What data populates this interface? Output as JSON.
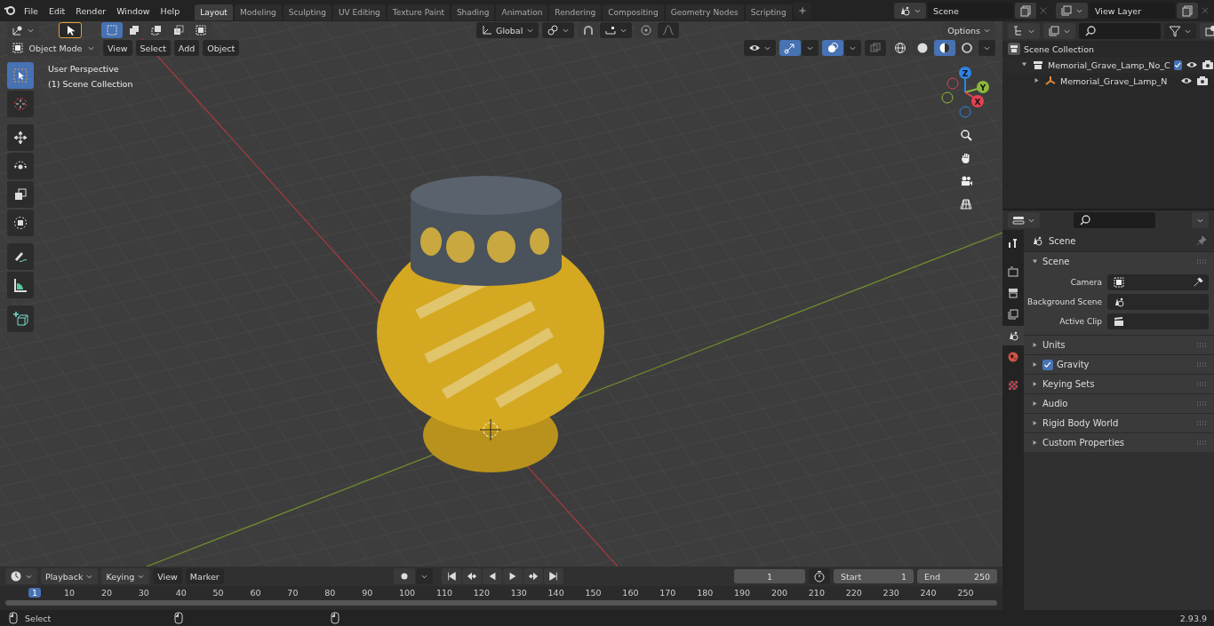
{
  "topbar": {
    "menus": [
      "File",
      "Edit",
      "Render",
      "Window",
      "Help"
    ],
    "workspaces": [
      {
        "label": "Layout",
        "selected": true
      },
      {
        "label": "Modeling",
        "selected": false
      },
      {
        "label": "Sculpting",
        "selected": false
      },
      {
        "label": "UV Editing",
        "selected": false
      },
      {
        "label": "Texture Paint",
        "selected": false
      },
      {
        "label": "Shading",
        "selected": false
      },
      {
        "label": "Animation",
        "selected": false
      },
      {
        "label": "Rendering",
        "selected": false
      },
      {
        "label": "Compositing",
        "selected": false
      },
      {
        "label": "Geometry Nodes",
        "selected": false
      },
      {
        "label": "Scripting",
        "selected": false
      }
    ],
    "scene": "Scene",
    "view_layer": "View Layer"
  },
  "viewport": {
    "selection_modes": [
      {
        "selected": true
      },
      {
        "selected": false
      },
      {
        "selected": false
      },
      {
        "selected": false
      },
      {
        "selected": false
      }
    ],
    "orientation": "Global",
    "options": "Options",
    "mode": "Object Mode",
    "menus": [
      "View",
      "Select",
      "Add",
      "Object"
    ],
    "gizmos_on": true,
    "overlays_on": true,
    "shading_modes": [
      {
        "kind": "wireframe",
        "selected": false
      },
      {
        "kind": "solid",
        "selected": false
      },
      {
        "kind": "material",
        "selected": true
      },
      {
        "kind": "rendered",
        "selected": false
      }
    ],
    "overlay_text": [
      "User Perspective",
      "(1) Scene Collection"
    ],
    "tools": [
      {
        "kind": "select",
        "selected": true
      },
      {
        "kind": "cursor",
        "selected": false
      },
      {
        "kind": "move",
        "selected": false
      },
      {
        "kind": "rotate",
        "selected": false
      },
      {
        "kind": "scale",
        "selected": false
      },
      {
        "kind": "transform",
        "selected": false
      },
      {
        "kind": "annotate",
        "selected": false
      },
      {
        "kind": "measure",
        "selected": false
      },
      {
        "kind": "add_cube",
        "selected": false
      }
    ],
    "gizmo_axes": [
      "Z",
      "Y",
      "X"
    ]
  },
  "outliner": {
    "tree": [
      {
        "label": "Scene Collection",
        "kind": "scene_collection",
        "children": [
          {
            "label": "Memorial_Grave_Lamp_No_C",
            "kind": "collection",
            "expanded": true,
            "checked": true,
            "children": [
              {
                "label": "Memorial_Grave_Lamp_N",
                "kind": "empty",
                "expanded": false
              }
            ]
          }
        ]
      }
    ]
  },
  "properties": {
    "tabs": [
      {
        "kind": "tool",
        "selected": false
      },
      {
        "kind": "render",
        "selected": false
      },
      {
        "kind": "output",
        "selected": false
      },
      {
        "kind": "view_layer",
        "selected": false
      },
      {
        "kind": "scene",
        "selected": true
      },
      {
        "kind": "world",
        "selected": false
      },
      {
        "kind": "texture",
        "selected": false
      }
    ],
    "context": "Scene",
    "panel": {
      "title": "Scene",
      "expanded": true,
      "fields": [
        {
          "label": "Camera",
          "kind": "camera"
        },
        {
          "label": "Background Scene",
          "kind": "scene"
        },
        {
          "label": "Active Clip",
          "kind": "clip"
        }
      ]
    },
    "subpanels": [
      {
        "label": "Units",
        "kind": "panel",
        "expanded": false
      },
      {
        "label": "Gravity",
        "kind": "checkbox",
        "checked": true,
        "expanded": false
      },
      {
        "label": "Keying Sets",
        "kind": "panel",
        "expanded": false
      },
      {
        "label": "Audio",
        "kind": "panel",
        "expanded": false
      },
      {
        "label": "Rigid Body World",
        "kind": "panel",
        "expanded": false
      },
      {
        "label": "Custom Properties",
        "kind": "panel",
        "expanded": false
      }
    ]
  },
  "timeline": {
    "menus": [
      {
        "label": "Playback",
        "dropdown": true
      },
      {
        "label": "Keying",
        "dropdown": true
      },
      {
        "label": "View",
        "dropdown": false
      },
      {
        "label": "Marker",
        "dropdown": false
      }
    ],
    "current_frame": "1",
    "start_label": "Start",
    "start": "1",
    "end_label": "End",
    "end": "250",
    "ruler": [
      {
        "label": "1",
        "selected": true
      },
      {
        "label": "10",
        "selected": false
      },
      {
        "label": "20",
        "selected": false
      },
      {
        "label": "30",
        "selected": false
      },
      {
        "label": "40",
        "selected": false
      },
      {
        "label": "50",
        "selected": false
      },
      {
        "label": "60",
        "selected": false
      },
      {
        "label": "70",
        "selected": false
      },
      {
        "label": "80",
        "selected": false
      },
      {
        "label": "90",
        "selected": false
      },
      {
        "label": "100",
        "selected": false
      },
      {
        "label": "110",
        "selected": false
      },
      {
        "label": "120",
        "selected": false
      },
      {
        "label": "130",
        "selected": false
      },
      {
        "label": "140",
        "selected": false
      },
      {
        "label": "150",
        "selected": false
      },
      {
        "label": "160",
        "selected": false
      },
      {
        "label": "170",
        "selected": false
      },
      {
        "label": "180",
        "selected": false
      },
      {
        "label": "190",
        "selected": false
      },
      {
        "label": "200",
        "selected": false
      },
      {
        "label": "210",
        "selected": false
      },
      {
        "label": "220",
        "selected": false
      },
      {
        "label": "230",
        "selected": false
      },
      {
        "label": "240",
        "selected": false
      },
      {
        "label": "250",
        "selected": false
      }
    ]
  },
  "status_bar": {
    "hint": "Select",
    "version": "2.93.9"
  }
}
